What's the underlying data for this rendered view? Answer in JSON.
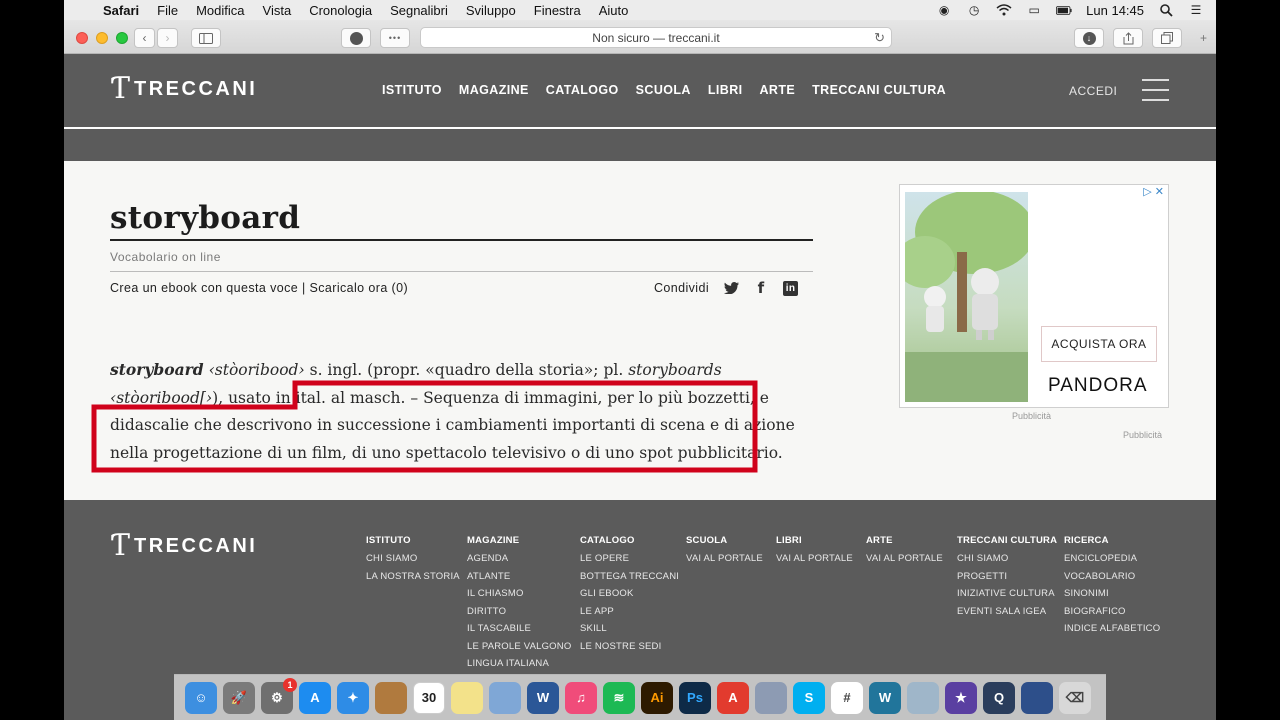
{
  "menubar": {
    "app": "Safari",
    "items": [
      "File",
      "Modifica",
      "Vista",
      "Cronologia",
      "Segnalibri",
      "Sviluppo",
      "Finestra",
      "Aiuto"
    ],
    "clock": "Lun 14:45"
  },
  "browser": {
    "address": "Non sicuro — treccani.it"
  },
  "site": {
    "logo_text": "TRECCANI",
    "nav": [
      "ISTITUTO",
      "MAGAZINE",
      "CATALOGO",
      "SCUOLA",
      "LIBRI",
      "ARTE",
      "TRECCANI CULTURA"
    ],
    "login": "ACCEDI"
  },
  "entry": {
    "title": "storyboard",
    "source": "Vocabolario on line",
    "ebook_text": "Crea un ebook con questa voce",
    "download_text": "Scaricalo ora",
    "download_count": "(0)",
    "share_label": "Condividi",
    "definition": {
      "headword": "storyboard",
      "pron": "‹stòoribood›",
      "pre": " s. ingl. (propr. «quadro della storia»; pl. ",
      "plural": "storyboards",
      "plural_pron": "‹stòoribood[›",
      "post": "), usato in ital. al masch. – ",
      "body": "Sequenza di immagini, per lo più bozzetti, e didascalie che descrivono in successione i cambiamenti importanti di scena e di azione nella progettazione di un film, di uno spettacolo televisivo o di uno spot pubblicitario."
    }
  },
  "ad": {
    "cta": "ACQUISTA ORA",
    "brand": "PANDORA",
    "caption": "Pubblicità",
    "caption2": "Pubblicità"
  },
  "footer": {
    "columns": [
      {
        "heading": "ISTITUTO",
        "items": [
          "CHI SIAMO",
          "LA NOSTRA STORIA"
        ]
      },
      {
        "heading": "MAGAZINE",
        "items": [
          "AGENDA",
          "ATLANTE",
          "IL CHIASMO",
          "DIRITTO",
          "IL TASCABILE",
          "LE PAROLE VALGONO",
          "LINGUA ITALIANA"
        ]
      },
      {
        "heading": "CATALOGO",
        "items": [
          "LE OPERE",
          "BOTTEGA TRECCANI",
          "GLI EBOOK",
          "LE APP",
          "SKILL",
          "LE NOSTRE SEDI"
        ]
      },
      {
        "heading": "SCUOLA",
        "items": [
          "VAI AL PORTALE"
        ]
      },
      {
        "heading": "LIBRI",
        "items": [
          "VAI AL PORTALE"
        ]
      },
      {
        "heading": "ARTE",
        "items": [
          "VAI AL PORTALE"
        ]
      },
      {
        "heading": "TRECCANI CULTURA",
        "items": [
          "CHI SIAMO",
          "PROGETTI",
          "INIZIATIVE CULTURA",
          "EVENTI SALA IGEA"
        ]
      },
      {
        "heading": "RICERCA",
        "items": [
          "ENCICLOPEDIA",
          "VOCABOLARIO",
          "SINONIMI",
          "BIOGRAFICO",
          "INDICE ALFABETICO"
        ]
      }
    ]
  },
  "dock": {
    "calendar_day": "30",
    "badge_count": "1",
    "icons": [
      "finder-icon",
      "launchpad-icon",
      "system-preferences-icon",
      "app-store-icon",
      "safari-icon",
      "notes-brown-icon",
      "calendar-icon",
      "stickies-icon",
      "preview-icon",
      "word-icon",
      "itunes-icon",
      "spotify-icon",
      "illustrator-icon",
      "photoshop-icon",
      "acrobat-icon",
      "image-capture-icon",
      "skype-icon",
      "slack-icon",
      "wordpress-icon",
      "script-editor-icon",
      "imovie-icon",
      "quicktime-icon",
      "archive-icon",
      "trash-icon"
    ]
  },
  "colors": {
    "header_gray": "#5b5b5b",
    "highlight_red": "#d0021b"
  }
}
